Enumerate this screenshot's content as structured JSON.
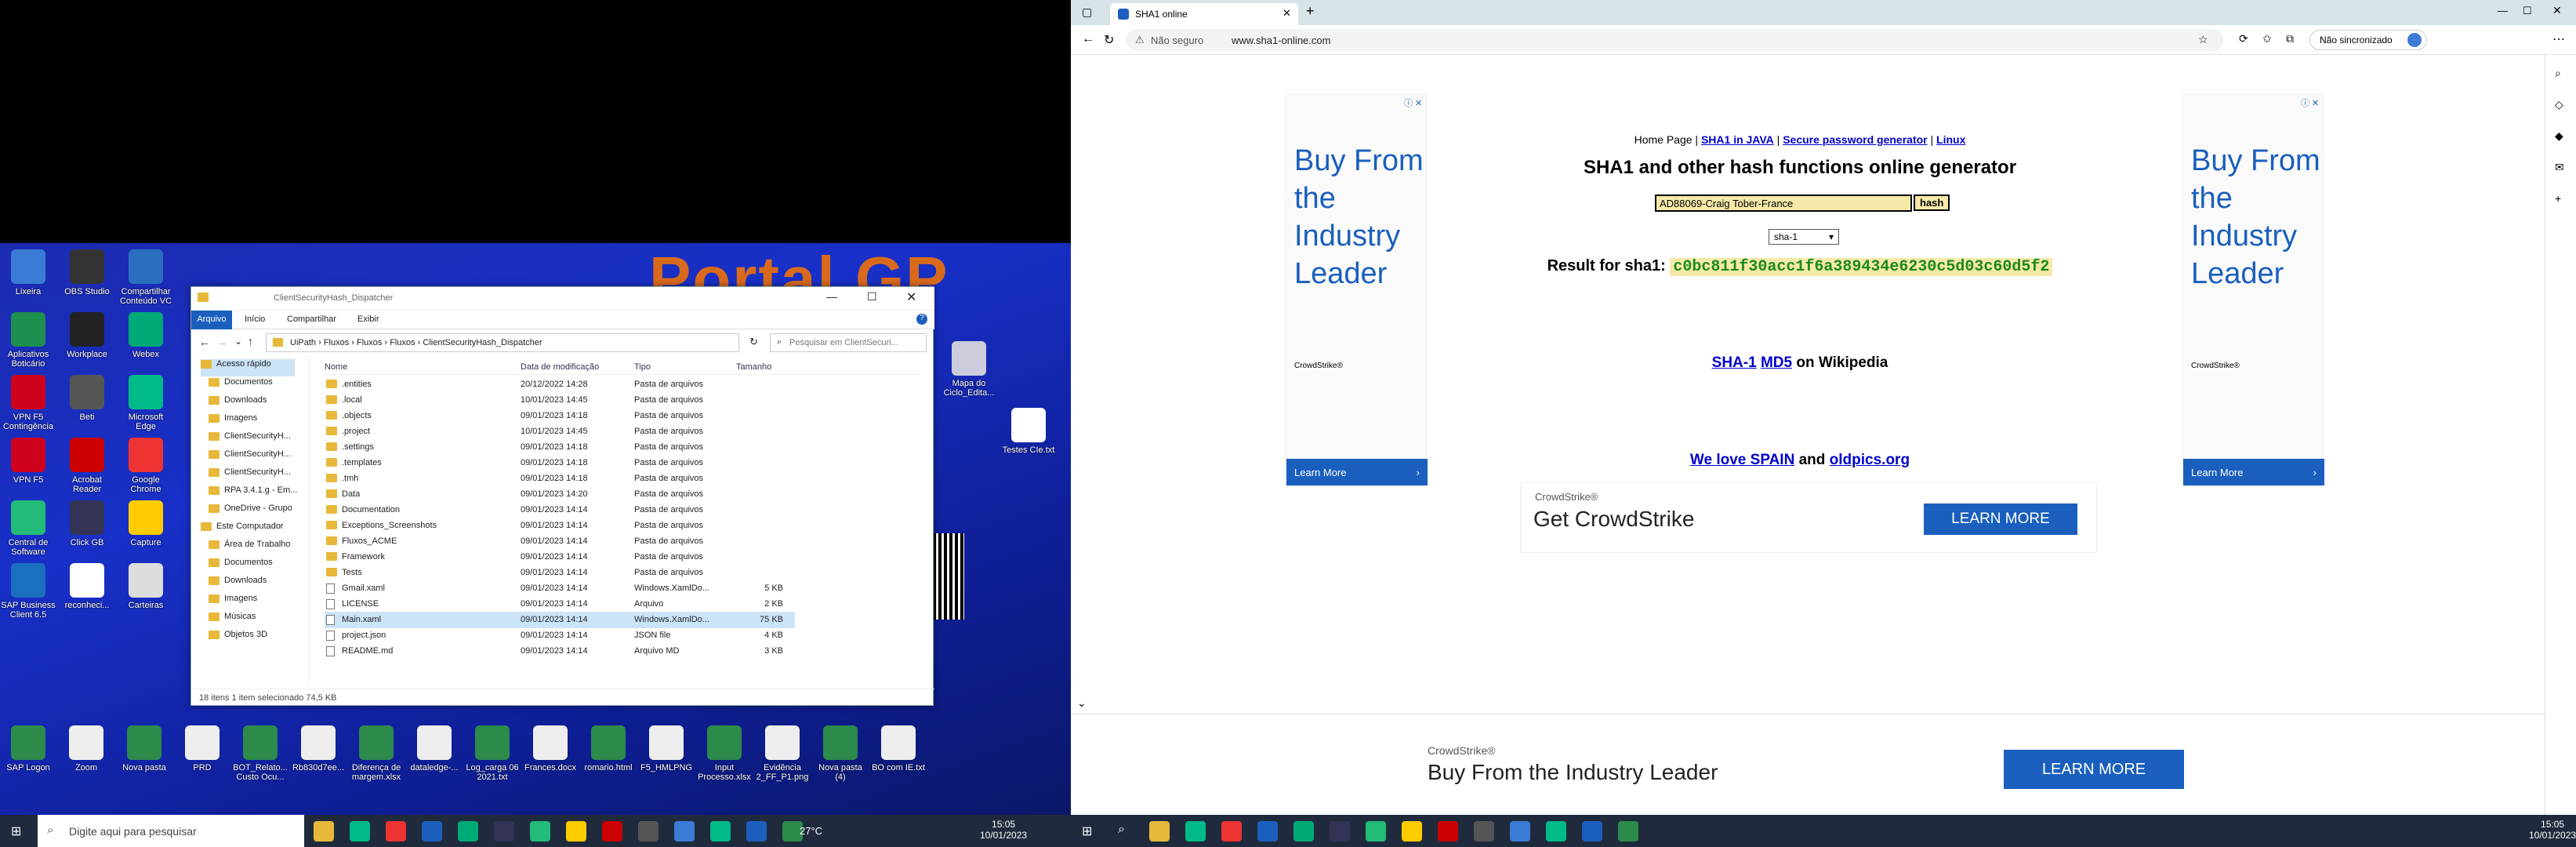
{
  "desktop": {
    "wallpaper_text": "Portal GP",
    "icons": [
      {
        "label": "Lixeira",
        "color": "#3a7bd5"
      },
      {
        "label": "OBS Studio",
        "color": "#333"
      },
      {
        "label": "Compartilhar Conteúdo VC",
        "color": "#2a6fbf"
      },
      {
        "label": "Aplicativos Boticário",
        "color": "#1d8f4e"
      },
      {
        "label": "Workplace",
        "color": "#222"
      },
      {
        "label": "Webex",
        "color": "#0a7"
      },
      {
        "label": "VPN F5 Contingência",
        "color": "#d0021b"
      },
      {
        "label": "Beti",
        "color": "#555"
      },
      {
        "label": "Microsoft Edge",
        "color": "#0b8"
      },
      {
        "label": "VPN F5",
        "color": "#d0021b"
      },
      {
        "label": "Acrobat Reader",
        "color": "#c00"
      },
      {
        "label": "Google Chrome",
        "color": "#e33"
      },
      {
        "label": "Central de Software",
        "color": "#2b7"
      },
      {
        "label": "Click GB",
        "color": "#335"
      },
      {
        "label": "Capture",
        "color": "#fc0"
      },
      {
        "label": "SAP Business Client 6.5",
        "color": "#1a6fbe"
      },
      {
        "label": "reconheci...",
        "color": "#fff"
      },
      {
        "label": "Carteiras",
        "color": "#ddd"
      }
    ],
    "bottom_icons": [
      "SAP Logon",
      "Zoom",
      "Nova pasta",
      "PRD",
      "BOT_Relato... Custo Ocu...",
      "Rb830d7ee...",
      "Diferença de margem.xlsx",
      "dataledge-...",
      "Log_carga 06 2021.txt",
      "Frances.docx",
      "romario.html",
      "F5_HMLPNG",
      "Input Processo.xlsx",
      "Evidência 2_FF_P1.png",
      "Nova pasta (4)",
      "BO com IE.txt"
    ],
    "right_icons": [
      "Mapa do Ciclo_Edita...",
      "Testes CIe.txt"
    ],
    "taskbar": {
      "search_placeholder": "Digite aqui para pesquisar",
      "weather": "27°C",
      "time": "15:05",
      "date": "10/01/2023"
    }
  },
  "explorer": {
    "title": "ClientSecurityHash_Dispatcher",
    "tabs": [
      "Arquivo",
      "Início",
      "Compartilhar",
      "Exibir"
    ],
    "path": [
      "UiPath",
      "Fluxos",
      "Fluxos",
      "Fluxos",
      "ClientSecurityHash_Dispatcher"
    ],
    "search_placeholder": "Pesquisar em ClientSecuri...",
    "nav": [
      "Acesso rápido",
      "Documentos",
      "Downloads",
      "Imagens",
      "ClientSecurityH...",
      "ClientSecurityH...",
      "ClientSecurityH...",
      "RPA 3.4.1.g - Em...",
      "OneDrive - Grupo",
      "Este Computador",
      "Área de Trabalho",
      "Documentos",
      "Downloads",
      "Imagens",
      "Músicas",
      "Objetos 3D"
    ],
    "columns": [
      "Nome",
      "Data de modificação",
      "Tipo",
      "Tamanho"
    ],
    "files": [
      {
        "name": ".entities",
        "date": "20/12/2022 14:28",
        "type": "Pasta de arquivos",
        "size": "",
        "folder": true
      },
      {
        "name": ".local",
        "date": "10/01/2023 14:45",
        "type": "Pasta de arquivos",
        "size": "",
        "folder": true
      },
      {
        "name": ".objects",
        "date": "09/01/2023 14:18",
        "type": "Pasta de arquivos",
        "size": "",
        "folder": true
      },
      {
        "name": ".project",
        "date": "10/01/2023 14:45",
        "type": "Pasta de arquivos",
        "size": "",
        "folder": true
      },
      {
        "name": ".settings",
        "date": "09/01/2023 14:18",
        "type": "Pasta de arquivos",
        "size": "",
        "folder": true
      },
      {
        "name": ".templates",
        "date": "09/01/2023 14:18",
        "type": "Pasta de arquivos",
        "size": "",
        "folder": true
      },
      {
        "name": ".tmh",
        "date": "09/01/2023 14:18",
        "type": "Pasta de arquivos",
        "size": "",
        "folder": true
      },
      {
        "name": "Data",
        "date": "09/01/2023 14:20",
        "type": "Pasta de arquivos",
        "size": "",
        "folder": true
      },
      {
        "name": "Documentation",
        "date": "09/01/2023 14:14",
        "type": "Pasta de arquivos",
        "size": "",
        "folder": true
      },
      {
        "name": "Exceptions_Screenshots",
        "date": "09/01/2023 14:14",
        "type": "Pasta de arquivos",
        "size": "",
        "folder": true
      },
      {
        "name": "Fluxos_ACME",
        "date": "09/01/2023 14:14",
        "type": "Pasta de arquivos",
        "size": "",
        "folder": true
      },
      {
        "name": "Framework",
        "date": "09/01/2023 14:14",
        "type": "Pasta de arquivos",
        "size": "",
        "folder": true
      },
      {
        "name": "Tests",
        "date": "09/01/2023 14:14",
        "type": "Pasta de arquivos",
        "size": "",
        "folder": true
      },
      {
        "name": "Gmail.xaml",
        "date": "09/01/2023 14:14",
        "type": "Windows.XamlDo...",
        "size": "5 KB",
        "folder": false
      },
      {
        "name": "LICENSE",
        "date": "09/01/2023 14:14",
        "type": "Arquivo",
        "size": "2 KB",
        "folder": false
      },
      {
        "name": "Main.xaml",
        "date": "09/01/2023 14:14",
        "type": "Windows.XamlDo...",
        "size": "75 KB",
        "folder": false
      },
      {
        "name": "project.json",
        "date": "09/01/2023 14:14",
        "type": "JSON file",
        "size": "4 KB",
        "folder": false
      },
      {
        "name": "README.md",
        "date": "09/01/2023 14:14",
        "type": "Arquivo MD",
        "size": "3 KB",
        "folder": false
      }
    ],
    "status": "18 itens    1 item selecionado  74,5 KB"
  },
  "browser": {
    "tab_title": "SHA1 online",
    "security": "Não seguro",
    "url": "www.sha1-online.com",
    "sync": "Não sincronizado",
    "nav_links": [
      "Home Page",
      "SHA1 in JAVA",
      "Secure password generator",
      "Linux"
    ],
    "heading": "SHA1 and other hash functions online generator",
    "input_value": "AD88069-Craig Tober-France",
    "hash_button": "hash",
    "algo": "sha-1",
    "result_label": "Result for sha1:",
    "result_hash": "c0bc811f30acc1f6a389434e6230c5d03c60d5f2",
    "wiki_links": [
      "SHA-1",
      "MD5"
    ],
    "wiki_text": "on Wikipedia",
    "spain_link": "We love SPAIN",
    "and_text": "and",
    "oldpics_link": "oldpics.org",
    "ad_side": {
      "text": "Buy From the Industry Leader",
      "brand": "CrowdStrike®",
      "cta": "Learn More"
    },
    "ad_mid": {
      "brand": "CrowdStrike®",
      "title": "Get CrowdStrike",
      "cta": "LEARN MORE"
    },
    "ad_bottom": {
      "brand": "CrowdStrike®",
      "title": "Buy From the Industry Leader",
      "cta": "LEARN MORE"
    },
    "taskbar": {
      "time": "15:05",
      "date": "10/01/2023"
    }
  }
}
